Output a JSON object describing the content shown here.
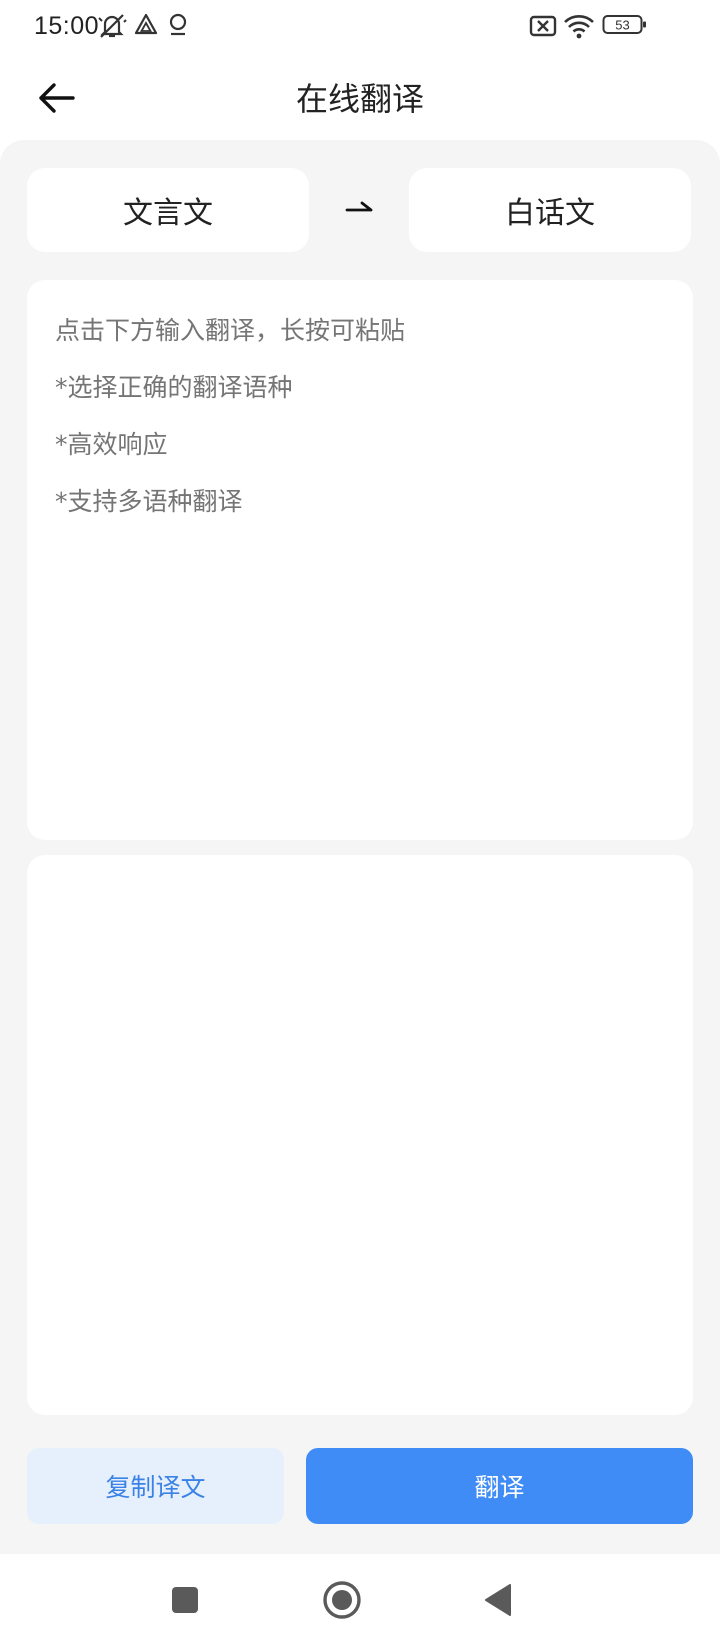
{
  "status_bar": {
    "time": "15:00",
    "battery_level": "53",
    "icons": [
      "muted-bell-icon",
      "drive-icon",
      "location-icon",
      "no-sim-icon",
      "wifi-icon",
      "battery-icon"
    ]
  },
  "app_bar": {
    "title": "在线翻译",
    "back_icon": "arrow-left-icon"
  },
  "language_selector": {
    "source": "文言文",
    "target": "白话文",
    "swap_icon": "swap-arrow-icon"
  },
  "input": {
    "value": "",
    "placeholder": "点击下方输入翻译，长按可粘贴\n*选择正确的翻译语种\n*高效响应\n*支持多语种翻译"
  },
  "output": {
    "value": ""
  },
  "actions": {
    "copy_label": "复制译文",
    "translate_label": "翻译"
  },
  "colors": {
    "primary": "#3f8cf6",
    "primary_light": "#e6f0fd",
    "background": "#f5f5f5",
    "placeholder": "#999999"
  },
  "nav_bar": {
    "icons": [
      "recent-apps-icon",
      "home-icon",
      "back-icon"
    ]
  }
}
